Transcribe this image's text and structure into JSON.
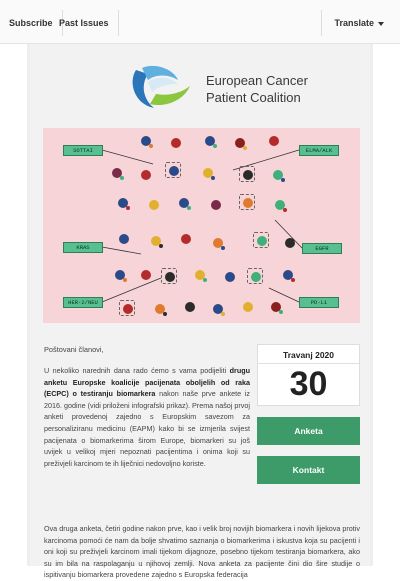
{
  "topbar": {
    "subscribe": "Subscribe",
    "past_issues": "Past Issues",
    "translate": "Translate"
  },
  "logo": {
    "line1": "European Cancer",
    "line2": "Patient Coalition"
  },
  "banner": {
    "labels": [
      "SOTTAI",
      "ELMA/ALK",
      "EGFR",
      "KRAS",
      "HER-2/NEU",
      "PD-L1"
    ]
  },
  "colors": {
    "accent_green": "#3d9a69",
    "banner_pink": "#f6d4d8",
    "label_green": "#58c090"
  },
  "body": {
    "greeting": "Poštovani članovi,",
    "p1_a": "U nekoliko narednih dana rado ćemo s vama podijeliti",
    "p1_bold": "drugu anketu Europske koalicije pacijenata oboljelih od raka (ECPC) o testiranju biomarkera",
    "p1_b": "nakon naše prve ankete iz 2016. godine (vidi priloženi infografski prikaz). Prema našoj prvoj anketi provedenoj zajedno s Europskim savezom za personaliziranu medicinu (EAPM) kako bi se izmjerila svijest pacijenata o biomarkerima širom Europe, biomarkeri su još uvijek u velikoj mjeri nepoznati pacijentima i onima koji su preživjeli karcinom te ih liječnici nedovoljno koriste.",
    "p2": "Ova druga anketa, četiri godine nakon prve, kao i velik broj novijih biomarkera i novih lijekova protiv karcinoma pomoći će nam da bolje shvatimo saznanja o biomarkerima i iskustva koja su pacijenti i oni koji su preživjeli karcinom imali tijekom dijagnoze, posebno tijekom testiranja biomarkera, ako su im bila na raspolaganju u njihovoj zemlji. Nova anketa za pacijente čini dio šire studije o ispitivanju biomarkera provedene zajedno s Europska federacija"
  },
  "sidebar": {
    "month": "Travanj 2020",
    "day": "30",
    "anketa": "Anketa",
    "kontakt": "Kontakt"
  }
}
